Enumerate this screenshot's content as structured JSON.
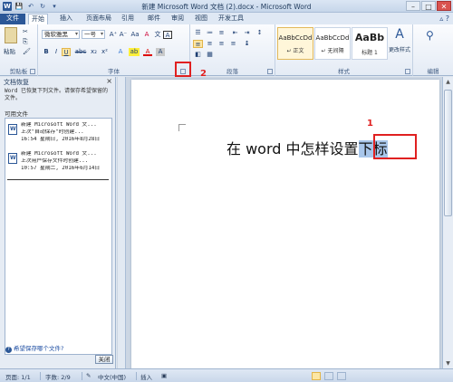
{
  "window": {
    "title": "新建 Microsoft Word 文档 (2).docx - Microsoft Word",
    "qat_logo": "W",
    "qat_save": "💾",
    "qat_undo": "↶",
    "qat_redo": "↻",
    "qat_more": "▾",
    "min": "–",
    "max": "□",
    "close": "✕"
  },
  "tabs": [
    "文件",
    "开始",
    "插入",
    "页面布局",
    "引用",
    "邮件",
    "审阅",
    "视图",
    "开发工具"
  ],
  "ribbon": {
    "clipboard": {
      "paste": "粘贴",
      "label": "剪贴板"
    },
    "font": {
      "font_name": "微软雅黑",
      "font_size": "一号",
      "grow": "A⁺",
      "shrink": "A⁻",
      "case": "Aa",
      "clear": "A",
      "wen": "文",
      "bold": "B",
      "italic": "I",
      "underline": "U",
      "strike": "abc",
      "sub": "x₂",
      "sup": "x²",
      "effects": "A",
      "highlight": "ab",
      "color": "A",
      "shade": "A",
      "border": "A",
      "label": "字体"
    },
    "paragraph": {
      "label": "段落"
    },
    "styles": {
      "items": [
        {
          "sample": "AaBbCcDd",
          "name": "↵ 正文"
        },
        {
          "sample": "AaBbCcDd",
          "name": "↵ 无间隔"
        },
        {
          "sample": "AaBb",
          "name": "标题 1"
        }
      ],
      "change": "更改样式",
      "label": "样式"
    },
    "editing": {
      "label": "编辑"
    }
  },
  "markers": {
    "one": "1",
    "two": "2"
  },
  "navpane": {
    "title": "文档恢复",
    "close": "×",
    "message": "Word 已恢复下列文件。请保存希望保留的文件。",
    "available": "可用文件",
    "files": [
      {
        "name": "新建 Microsoft Word 文...",
        "desc": "上次\"自动保存\"时创建...",
        "time": "16:54 星期日, 2016年8月28日"
      },
      {
        "name": "新建 Microsoft Word 文...",
        "desc": "上次用户保存文件时创建...",
        "time": "10:57 星期二, 2016年6月14日"
      }
    ],
    "which_file": "哪个文件?",
    "which_prefix": "希望保存",
    "close_btn": "关闭"
  },
  "document": {
    "text_before": "在 word 中怎样设置",
    "text_selected": "下标"
  },
  "statusbar": {
    "page": "页面: 1/1",
    "words": "字数: 2/9",
    "lang": "中文(中国)",
    "insert": "插入"
  },
  "colors": {
    "accent": "#2b5797",
    "marker": "#e02020",
    "highlight": "#a8c6ea"
  }
}
